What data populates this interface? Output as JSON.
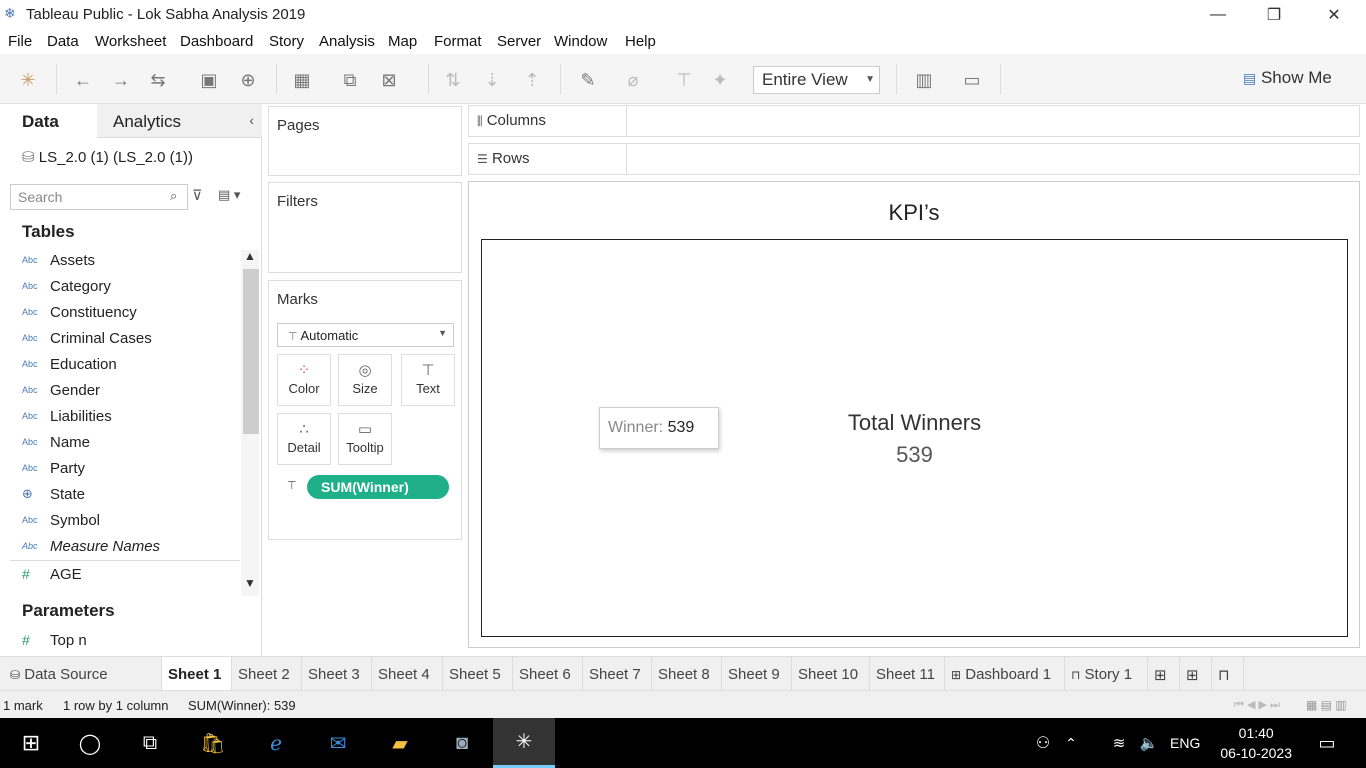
{
  "window": {
    "title": "Tableau Public - Lok Sabha Analysis 2019"
  },
  "menu": [
    "File",
    "Data",
    "Worksheet",
    "Dashboard",
    "Story",
    "Analysis",
    "Map",
    "Format",
    "Server",
    "Window",
    "Help"
  ],
  "toolbar": {
    "fit_value": "Entire View",
    "show_me_label": "Show Me"
  },
  "data_pane": {
    "tab_data": "Data",
    "tab_analytics": "Analytics",
    "datasource": "LS_2.0 (1) (LS_2.0 (1))",
    "search_placeholder": "Search",
    "tables_heading": "Tables",
    "fields": [
      {
        "type": "Abc",
        "name": "Assets"
      },
      {
        "type": "Abc",
        "name": "Category"
      },
      {
        "type": "Abc",
        "name": "Constituency"
      },
      {
        "type": "Abc",
        "name": "Criminal Cases"
      },
      {
        "type": "Abc",
        "name": "Education"
      },
      {
        "type": "Abc",
        "name": "Gender"
      },
      {
        "type": "Abc",
        "name": "Liabilities"
      },
      {
        "type": "Abc",
        "name": "Name"
      },
      {
        "type": "Abc",
        "name": "Party"
      },
      {
        "type": "globe",
        "name": "State"
      },
      {
        "type": "Abc",
        "name": "Symbol"
      },
      {
        "type": "Abc",
        "name": "Measure Names"
      },
      {
        "type": "#",
        "name": "AGE"
      }
    ],
    "parameters_heading": "Parameters",
    "parameters": [
      {
        "type": "#",
        "name": "Top n"
      }
    ]
  },
  "shelves": {
    "pages": "Pages",
    "filters": "Filters",
    "marks": "Marks",
    "mark_type": "Automatic",
    "mark_buttons": [
      "Color",
      "Size",
      "Text",
      "Detail",
      "Tooltip"
    ],
    "pill": "SUM(Winner)",
    "columns": "Columns",
    "rows": "Rows"
  },
  "view": {
    "title": "KPI’s",
    "kpi_label": "Total Winners",
    "kpi_value": "539",
    "tooltip_label": "Winner:",
    "tooltip_value": "539"
  },
  "sheet_tabs": [
    "Data Source",
    "Sheet 1",
    "Sheet 2",
    "Sheet 3",
    "Sheet 4",
    "Sheet 5",
    "Sheet 6",
    "Sheet 7",
    "Sheet 8",
    "Sheet 9",
    "Sheet 10",
    "Sheet 11",
    "Dashboard 1",
    "Story 1"
  ],
  "active_tab": "Sheet 1",
  "status": {
    "marks": "1 mark",
    "dims": "1 row by 1 column",
    "sum": "SUM(Winner): 539"
  },
  "taskbar": {
    "lang": "ENG",
    "time": "01:40",
    "date": "06-10-2023"
  },
  "colors": {
    "pill": "#1fb08a",
    "taskbar": "#000000"
  }
}
